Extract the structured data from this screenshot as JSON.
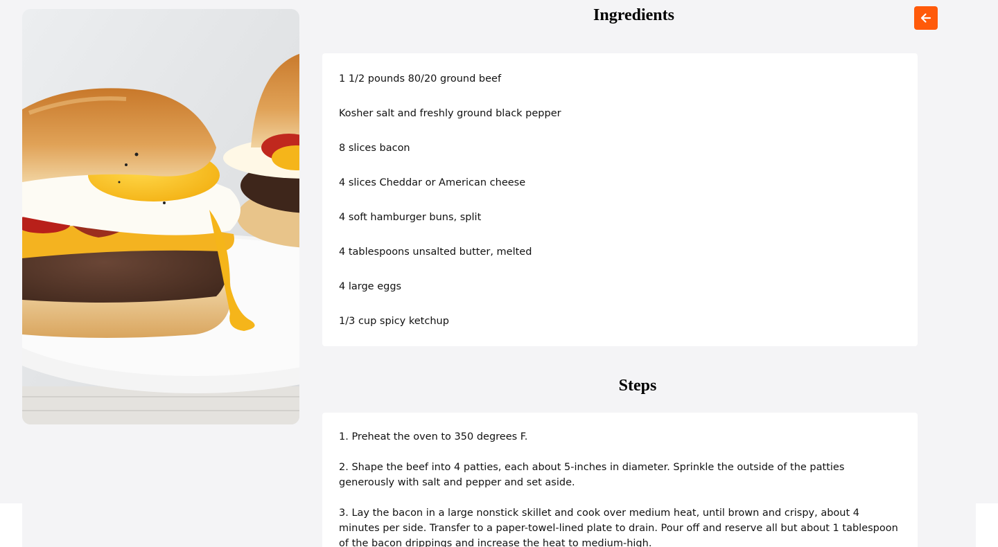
{
  "ingredients": {
    "heading": "Ingredients",
    "items": [
      "1 1/2 pounds 80/20 ground beef",
      "Kosher salt and freshly ground black pepper",
      "8 slices bacon",
      "4 slices Cheddar or American cheese",
      "4 soft hamburger buns, split",
      "4 tablespoons unsalted butter, melted",
      "4 large eggs",
      "1/3 cup spicy ketchup"
    ]
  },
  "steps": {
    "heading": "Steps",
    "items": [
      "1. Preheat the oven to 350 degrees F.",
      "2. Shape the beef into 4 patties, each about 5-inches in diameter. Sprinkle the outside of the patties generously with salt and pepper and set aside.",
      "3. Lay the bacon in a large nonstick skillet and cook over medium heat, until brown and crispy, about 4 minutes per side. Transfer to a paper-towel-lined plate to drain. Pour off and reserve all but about 1 tablespoon of the bacon drippings and increase the heat to medium-high."
    ]
  },
  "back_button": {
    "icon": "arrow-left-icon"
  },
  "colors": {
    "accent": "#ff5a0a",
    "page_background": "#f4f4f6",
    "card_background": "#ffffff"
  }
}
